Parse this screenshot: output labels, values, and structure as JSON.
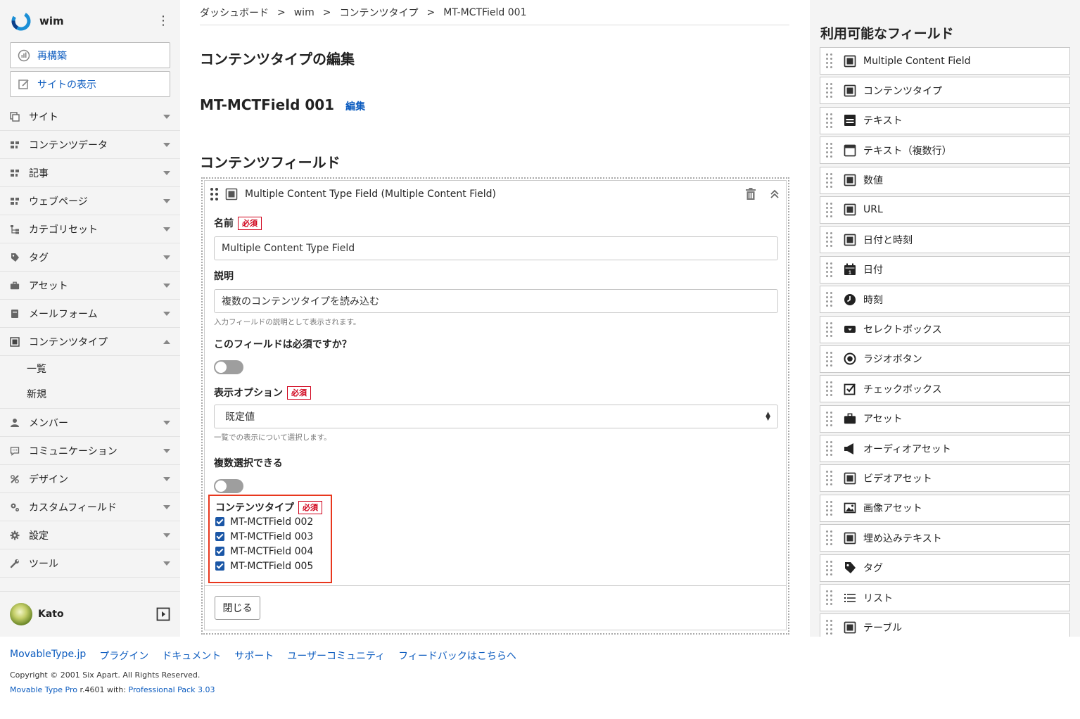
{
  "sidebar": {
    "site_name": "wim",
    "rebuild_label": "再構築",
    "view_site_label": "サイトの表示",
    "items": [
      {
        "label": "サイト",
        "icon": "site-icon"
      },
      {
        "label": "コンテンツデータ",
        "icon": "grid-icon"
      },
      {
        "label": "記事",
        "icon": "grid-icon"
      },
      {
        "label": "ウェブページ",
        "icon": "grid-icon"
      },
      {
        "label": "カテゴリセット",
        "icon": "tree-icon"
      },
      {
        "label": "タグ",
        "icon": "tag-icon"
      },
      {
        "label": "アセット",
        "icon": "briefcase-icon"
      },
      {
        "label": "メールフォーム",
        "icon": "form-icon"
      },
      {
        "label": "コンテンツタイプ",
        "icon": "content-type-icon"
      }
    ],
    "sub_items": [
      {
        "label": "一覧"
      },
      {
        "label": "新規"
      }
    ],
    "items_after": [
      {
        "label": "メンバー",
        "icon": "user-icon"
      },
      {
        "label": "コミュニケーション",
        "icon": "comment-icon"
      },
      {
        "label": "デザイン",
        "icon": "design-icon"
      },
      {
        "label": "カスタムフィールド",
        "icon": "custom-field-icon"
      },
      {
        "label": "設定",
        "icon": "gear-icon"
      },
      {
        "label": "ツール",
        "icon": "wrench-icon"
      }
    ],
    "user_name": "Kato"
  },
  "breadcrumb": [
    "ダッシュボード",
    "wim",
    "コンテンツタイプ",
    "MT-MCTField 001"
  ],
  "page_title": "コンテンツタイプの編集",
  "content_type_name": "MT-MCTField 001",
  "edit_label": "編集",
  "section_title": "コンテンツフィールド",
  "field": {
    "header": "Multiple Content Type Field (Multiple Content Field)",
    "name_label": "名前",
    "required": "必須",
    "name_value": "Multiple Content Type Field",
    "desc_label": "説明",
    "desc_value": "複数のコンテンツタイプを読み込む",
    "desc_help": "入力フィールドの説明として表示されます。",
    "required_question": "このフィールドは必須ですか？",
    "display_label": "表示オプション",
    "display_value": "既定値",
    "display_help": "一覧での表示について選択します。",
    "multi_label": "複数選択できる",
    "ct_label": "コンテンツタイプ",
    "ct_options": [
      "MT-MCTField 002",
      "MT-MCTField 003",
      "MT-MCTField 004",
      "MT-MCTField 005"
    ],
    "close_label": "閉じる"
  },
  "right_panel": {
    "title": "利用可能なフィールド",
    "items": [
      {
        "label": "Multiple Content Field",
        "icon": "content-field-icon"
      },
      {
        "label": "コンテンツタイプ",
        "icon": "content-field-icon"
      },
      {
        "label": "テキスト",
        "icon": "text-icon"
      },
      {
        "label": "テキスト（複数行）",
        "icon": "textarea-icon"
      },
      {
        "label": "数値",
        "icon": "content-field-icon"
      },
      {
        "label": "URL",
        "icon": "content-field-icon"
      },
      {
        "label": "日付と時刻",
        "icon": "content-field-icon"
      },
      {
        "label": "日付",
        "icon": "calendar-icon"
      },
      {
        "label": "時刻",
        "icon": "clock-icon"
      },
      {
        "label": "セレクトボックス",
        "icon": "select-icon"
      },
      {
        "label": "ラジオボタン",
        "icon": "radio-icon"
      },
      {
        "label": "チェックボックス",
        "icon": "checkbox-icon"
      },
      {
        "label": "アセット",
        "icon": "briefcase-icon"
      },
      {
        "label": "オーディオアセット",
        "icon": "speaker-icon"
      },
      {
        "label": "ビデオアセット",
        "icon": "content-field-icon"
      },
      {
        "label": "画像アセット",
        "icon": "image-icon"
      },
      {
        "label": "埋め込みテキスト",
        "icon": "content-field-icon"
      },
      {
        "label": "タグ",
        "icon": "tag-icon"
      },
      {
        "label": "リスト",
        "icon": "list-icon"
      },
      {
        "label": "テーブル",
        "icon": "content-field-icon"
      }
    ]
  },
  "footer": {
    "links": [
      "MovableType.jp",
      "プラグイン",
      "ドキュメント",
      "サポート",
      "ユーザーコミュニティ",
      "フィードバックはこちらへ"
    ],
    "copyright": "Copyright © 2001 Six Apart. All Rights Reserved.",
    "version_prefix": "Movable Type Pro",
    "version_text": " r.4601 with: ",
    "version_link": "Professional Pack 3.03"
  }
}
